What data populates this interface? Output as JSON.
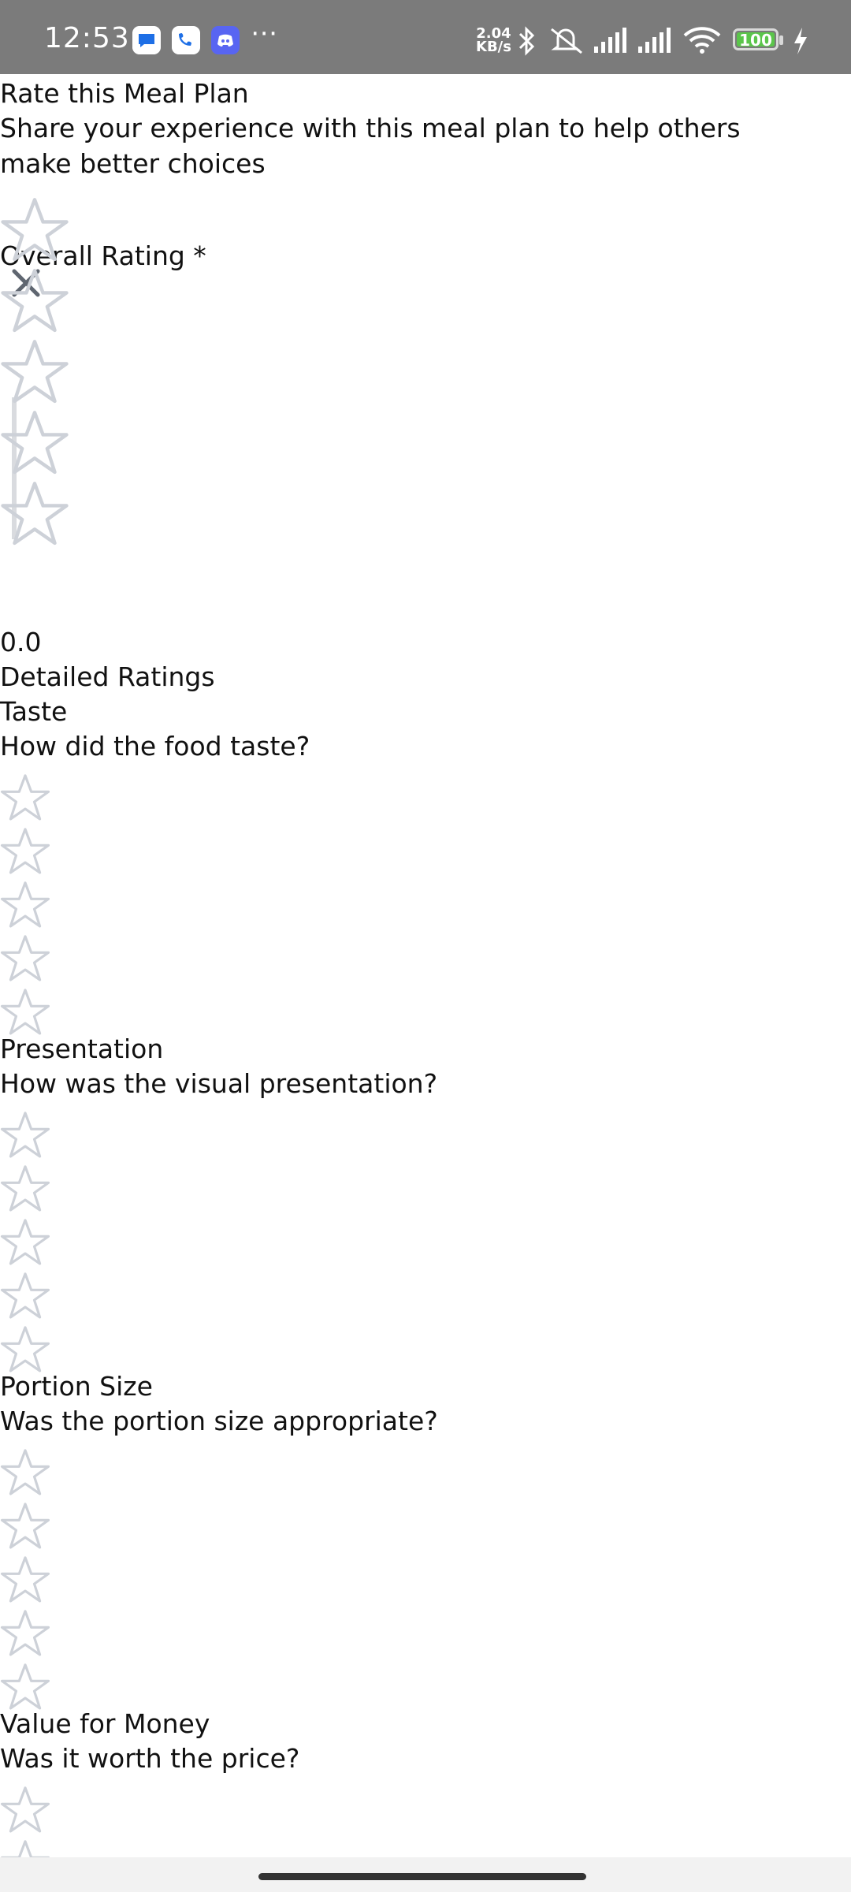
{
  "status": {
    "time": "12:53",
    "speed_value": "2.04",
    "speed_unit": "KB/s",
    "battery": "100"
  },
  "modal": {
    "title": "Rate this Meal Plan",
    "description": "Share your experience with this meal plan to help others make better choices",
    "overall_label": "Overall Rating *",
    "overall_value": "0.0",
    "overall_stars_filled": 0,
    "detailed_heading": "Detailed Ratings",
    "categories": [
      {
        "label": "Taste",
        "question": "How did the food taste?",
        "rating": 0
      },
      {
        "label": "Presentation",
        "question": "How was the visual presentation?",
        "rating": 0
      },
      {
        "label": "Portion Size",
        "question": "Was the portion size appropriate?",
        "rating": 0
      },
      {
        "label": "Value for Money",
        "question": "Was it worth the price?",
        "rating": 0
      }
    ]
  },
  "colors": {
    "star_empty": "#cdd1d8",
    "statusbar": "#7b7b7b",
    "battery_fill": "#5ac54a"
  },
  "icons": [
    "message-icon",
    "phone-icon",
    "discord-icon",
    "bluetooth-icon",
    "mute-icon",
    "signal-icon",
    "wifi-icon",
    "battery-icon",
    "charging-icon",
    "close-icon",
    "star-icon"
  ]
}
